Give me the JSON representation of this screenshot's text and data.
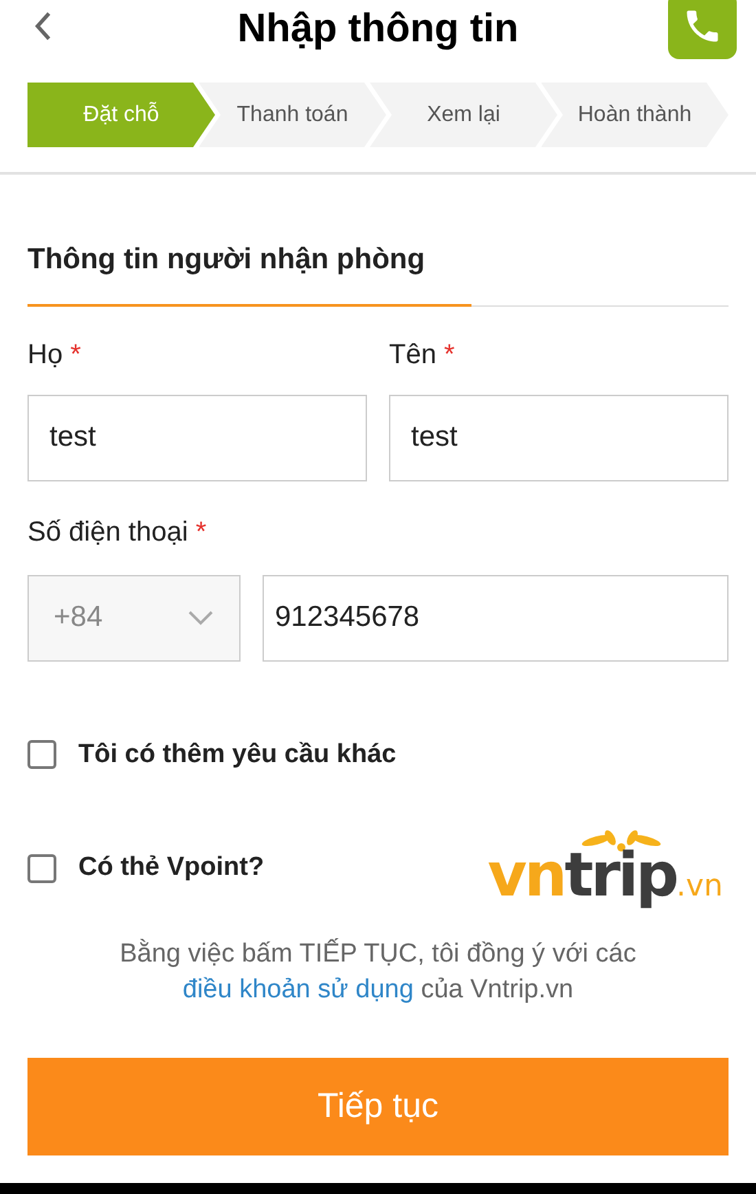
{
  "header": {
    "title": "Nhập thông tin"
  },
  "steps": [
    {
      "label": "Đặt chỗ",
      "selected": true
    },
    {
      "label": "Thanh toán",
      "selected": false
    },
    {
      "label": "Xem lại",
      "selected": false
    },
    {
      "label": "Hoàn thành",
      "selected": false
    }
  ],
  "section_title": "Thông tin người nhận phòng",
  "name_fields": [
    {
      "label": "Họ",
      "required": "*",
      "value": "test"
    },
    {
      "label": "Tên",
      "required": "*",
      "value": "test"
    }
  ],
  "phone": {
    "label": "Số điện thoại",
    "required": "*",
    "country_code": "+84",
    "value": "912345678"
  },
  "options": [
    {
      "label": "Tôi có thêm yêu cầu khác",
      "checked": false
    },
    {
      "label": "Có thẻ Vpoint?",
      "checked": false
    }
  ],
  "logo": {
    "part_1": "vn",
    "part_2": "trip",
    "suffix": ".vn"
  },
  "terms": {
    "before": "Bằng việc bấm TIẾP TỤC, tôi đồng ý với các",
    "link": "điều khoản sử dụng",
    "after": "của Vntrip.vn"
  },
  "submit_button": "Tiếp tục"
}
